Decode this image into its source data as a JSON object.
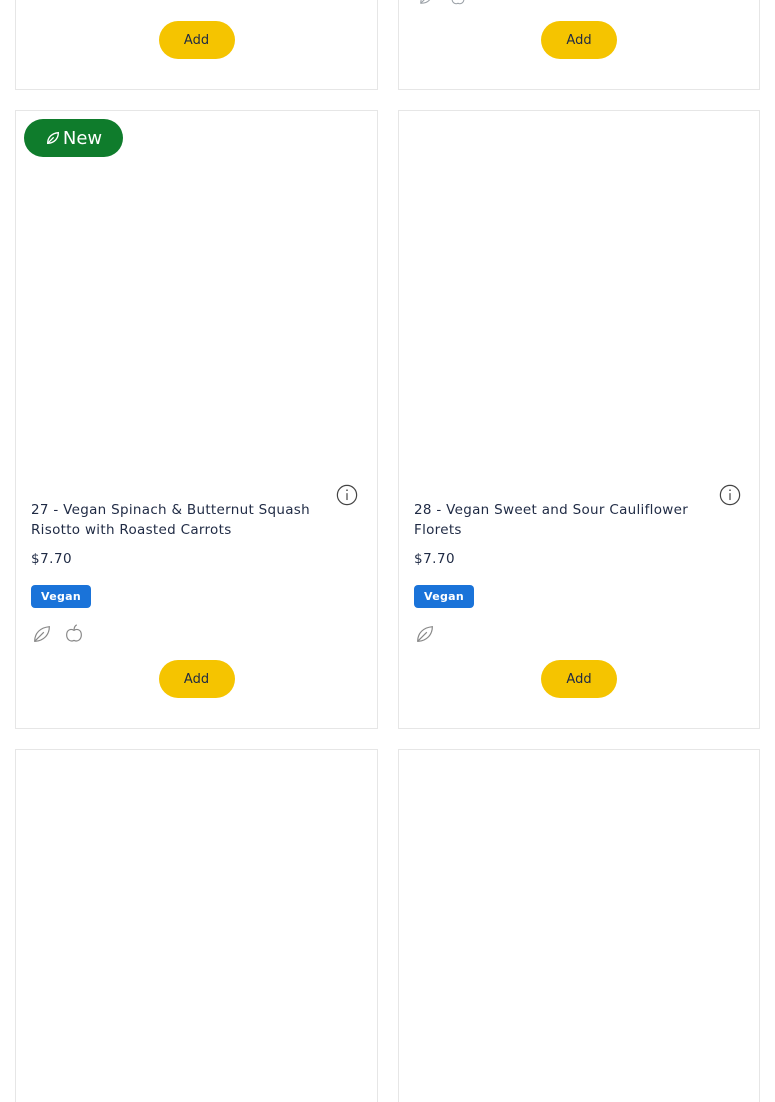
{
  "top_row": {
    "left": {
      "add_label": "Add"
    },
    "right": {
      "add_label": "Add",
      "icons": [
        "leaf-outline-icon",
        "apple-outline-icon"
      ]
    }
  },
  "products": [
    {
      "badge": "New",
      "title": "27 - Vegan Spinach & Butternut Squash Risotto with Roasted Carrots",
      "price": "$7.70",
      "tag": "Vegan",
      "icons": [
        "leaf-outline-icon",
        "apple-outline-icon"
      ],
      "add_label": "Add"
    },
    {
      "title": "28 - Vegan Sweet and Sour Cauliflower Florets",
      "price": "$7.70",
      "tag": "Vegan",
      "icons": [
        "leaf-outline-icon"
      ],
      "add_label": "Add"
    }
  ],
  "colors": {
    "add_button": "#f5c400",
    "new_badge": "#0f7c2c",
    "vegan_tag": "#1a73d9",
    "text": "#1f2a44",
    "card_border": "#e6e6e6"
  }
}
